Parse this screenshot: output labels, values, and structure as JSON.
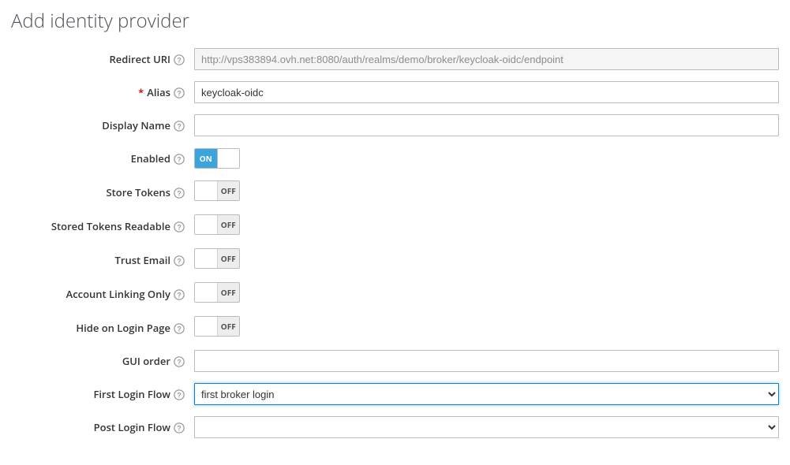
{
  "page": {
    "title": "Add identity provider"
  },
  "toggle_labels": {
    "on": "ON",
    "off": "OFF"
  },
  "fields": {
    "redirect_uri": {
      "label": "Redirect URI",
      "value": "http://vps383894.ovh.net:8080/auth/realms/demo/broker/keycloak-oidc/endpoint"
    },
    "alias": {
      "label": "Alias",
      "value": "keycloak-oidc",
      "required": "*"
    },
    "display_name": {
      "label": "Display Name",
      "value": ""
    },
    "enabled": {
      "label": "Enabled",
      "value": "on"
    },
    "store_tokens": {
      "label": "Store Tokens",
      "value": "off"
    },
    "stored_tokens_readable": {
      "label": "Stored Tokens Readable",
      "value": "off"
    },
    "trust_email": {
      "label": "Trust Email",
      "value": "off"
    },
    "account_linking_only": {
      "label": "Account Linking Only",
      "value": "off"
    },
    "hide_on_login_page": {
      "label": "Hide on Login Page",
      "value": "off"
    },
    "gui_order": {
      "label": "GUI order",
      "value": ""
    },
    "first_login_flow": {
      "label": "First Login Flow",
      "value": "first broker login"
    },
    "post_login_flow": {
      "label": "Post Login Flow",
      "value": ""
    }
  }
}
